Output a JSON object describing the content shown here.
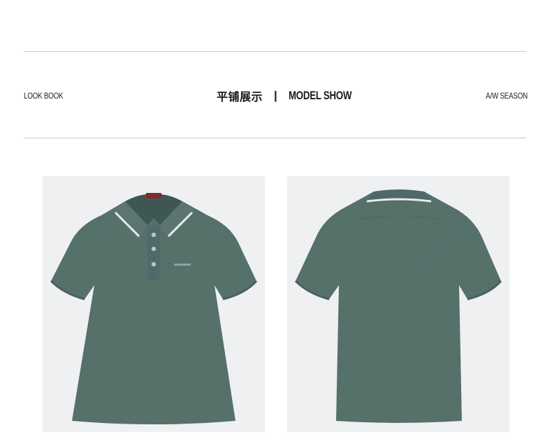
{
  "header": {
    "left_label": "LOOK BOOK",
    "title_cn": "平铺展示",
    "separator": "|",
    "title_en": "MODEL SHOW",
    "right_label": "A/W SEASON"
  },
  "products": [
    {
      "view": "front",
      "color": "#56706a"
    },
    {
      "view": "back",
      "color": "#56706a"
    }
  ]
}
